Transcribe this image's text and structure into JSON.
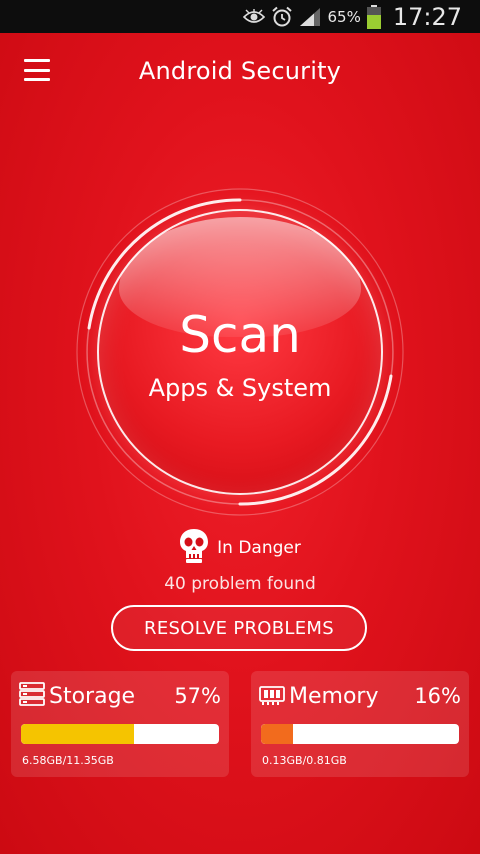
{
  "status_bar": {
    "battery_percent": "65%",
    "time": "17:27",
    "icons": [
      "eye-icon",
      "alarm-icon",
      "signal-icon",
      "battery-icon"
    ]
  },
  "app_bar": {
    "title": "Android Security"
  },
  "scan": {
    "title": "Scan",
    "subtitle": "Apps & System"
  },
  "status": {
    "label": "In Danger",
    "problems": "40 problem found"
  },
  "resolve_button": {
    "label": "RESOLVE PROBLEMS"
  },
  "storage": {
    "label": "Storage",
    "percent": "57%",
    "fill": 0.57,
    "detail": "6.58GB/11.35GB",
    "color": "#f5c400"
  },
  "memory": {
    "label": "Memory",
    "percent": "16%",
    "fill": 0.16,
    "detail": "0.13GB/0.81GB",
    "color": "#f26b1d"
  },
  "colors": {
    "background": "#e0121c",
    "accent": "#ffffff"
  }
}
